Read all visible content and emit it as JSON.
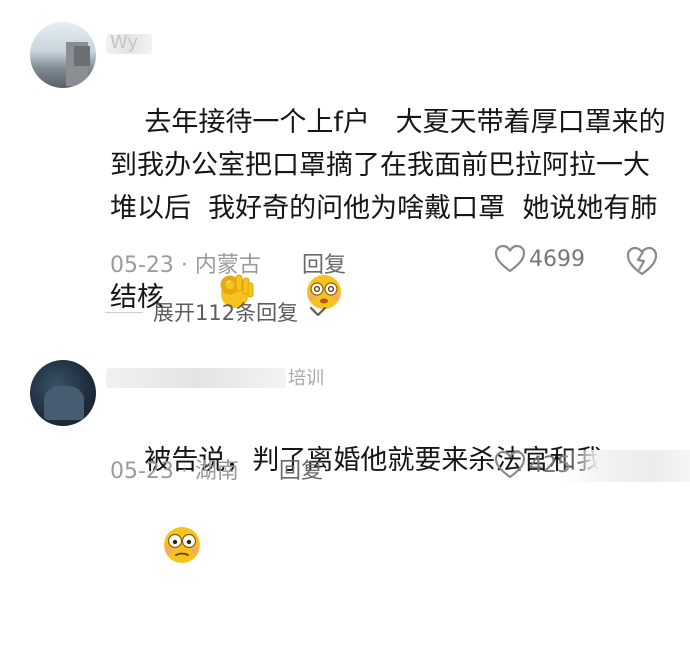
{
  "comments": [
    {
      "username": "Wy",
      "text": "去年接待一个上f户   大夏天带着厚口罩来的到我办公室把口罩摘了在我面前巴拉阿拉一大堆以后  我好奇的问他为啥戴口罩  她说她有肺结核",
      "emojis": [
        "ok-hand-emoji",
        "dizzy-face-emoji"
      ],
      "date": "05-23",
      "location": "内蒙古",
      "reply_label": "回复",
      "likes": "4699",
      "expand_label": "展开112条回复"
    },
    {
      "username": "培训",
      "text": "被告说，判了离婚他就要来杀法官和我",
      "emojis": [
        "flushed-face-emoji"
      ],
      "date": "05-23",
      "location": "湖南",
      "reply_label": "回复",
      "likes": "425"
    }
  ],
  "separator": " · ",
  "colors": {
    "meta": "#9b9b9b",
    "text": "#161616",
    "emoji_yellow": "#f6c21c"
  }
}
